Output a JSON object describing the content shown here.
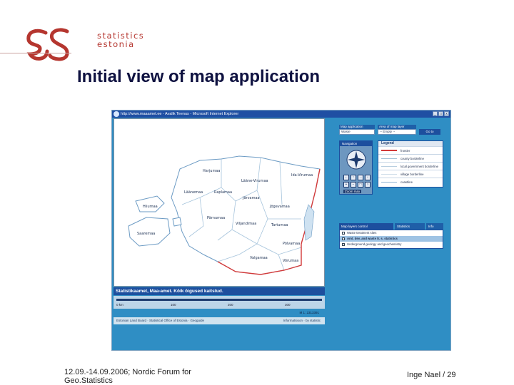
{
  "logo": {
    "line1": "statistics",
    "line2": "estonia",
    "brand_color": "#b5362f"
  },
  "slide": {
    "title": "Initial view of map application"
  },
  "browser": {
    "window_title": "http://www.maaamet.ee - Avalik Teenus - Microsoft Internet Explorer",
    "buttons": {
      "minimize": "_",
      "maximize": "□",
      "close": "x"
    }
  },
  "map": {
    "counties": [
      "Harjumaa",
      "Lääne-Virumaa",
      "Ida-Virumaa",
      "Hiiumaa",
      "Läänemaa",
      "Raplamaa",
      "Järvamaa",
      "Jõgevamaa",
      "Saaremaa",
      "Pärnumaa",
      "Viljandimaa",
      "Tartumaa",
      "Põlvamaa",
      "Valgamaa",
      "Võrumaa"
    ],
    "attribution": "Statistikaamet, Maa-amet. Kõik õigused kaitstud.",
    "scale_labels": [
      "0 km",
      "100",
      "200",
      "300"
    ],
    "scale_ratio": "M 1: 2313391",
    "status_left": "Estonian Land Board  ·  Statistical Office of Estonia  ·  Geoguide",
    "status_right": "Informatsioon  ·  by statistic"
  },
  "controls": {
    "app_label": "Map application",
    "app_value": "Waste",
    "area_label": "Area of map layer",
    "area_value": "-- Empty --",
    "go_button": "Go to",
    "navigation_label": "Navigation",
    "nav_buttons": [
      "←",
      "↑",
      "→",
      "↓",
      "+",
      "−",
      "□",
      "○"
    ],
    "navigation_hint": "Zoom max",
    "legend_title": "Legend",
    "legend_items": [
      {
        "label": "frontier",
        "color": "#d23a3a"
      },
      {
        "label": "county borderline",
        "color": "#9fc0d8"
      },
      {
        "label": "local government borderline",
        "color": "#b9cfe0"
      },
      {
        "label": "village borderline",
        "color": "#cfdde9"
      },
      {
        "label": "coastline",
        "color": "#8fb4d4"
      }
    ],
    "tabs": [
      "Map layers control",
      "Statistics",
      "Info"
    ],
    "layers": [
      "Waste treatment sites",
      "Amt. dev. and waste tr. s. statistics",
      "Underground geology and geochemistry"
    ]
  },
  "footer": {
    "left_line1": "12.09.-14.09.2006; Nordic Forum for",
    "left_line2": "Geo.Statistics",
    "right": "Inge Nael / 29"
  },
  "colors": {
    "map_water": "#ffffff",
    "land": "#ffffff",
    "frontier": "#d23a3a",
    "app_bg": "#2f8ec4",
    "bar": "#1d4f9e"
  }
}
